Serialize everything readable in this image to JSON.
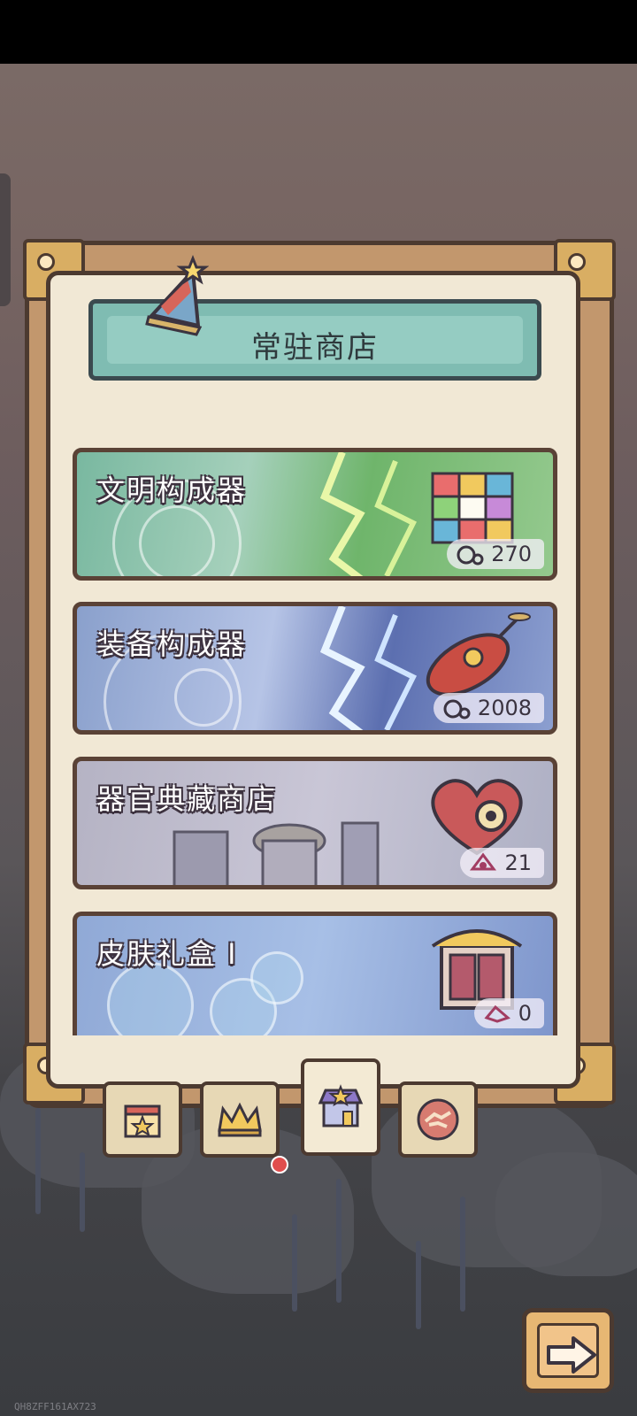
{
  "header": {
    "title": "常驻商店"
  },
  "shop_items": [
    {
      "name": "文明构成器",
      "price": "270",
      "currency_icon": "gear-coin-icon",
      "art_icon": "rubik-cube-icon"
    },
    {
      "name": "装备构成器",
      "price": "2008",
      "currency_icon": "gear-coin-icon",
      "art_icon": "rocket-pod-icon"
    },
    {
      "name": "器官典藏商店",
      "price": "21",
      "currency_icon": "organ-token-icon",
      "art_icon": "mechanical-heart-icon"
    },
    {
      "name": "皮肤礼盒 I",
      "price": "0",
      "currency_icon": "skin-token-icon",
      "art_icon": "ornate-box-icon"
    }
  ],
  "bottom_tabs": [
    {
      "id": "calendar",
      "icon": "calendar-star-icon"
    },
    {
      "id": "crown",
      "icon": "crown-icon"
    },
    {
      "id": "shop",
      "icon": "shop-stall-icon"
    },
    {
      "id": "handshake",
      "icon": "handshake-icon"
    }
  ],
  "footer": {
    "watermark": "QH8ZFF161AX723"
  },
  "colors": {
    "accent": "#7fbcb2",
    "frame": "#4c3a30",
    "panel": "#f1e8d5",
    "notification": "#e04d4d"
  }
}
